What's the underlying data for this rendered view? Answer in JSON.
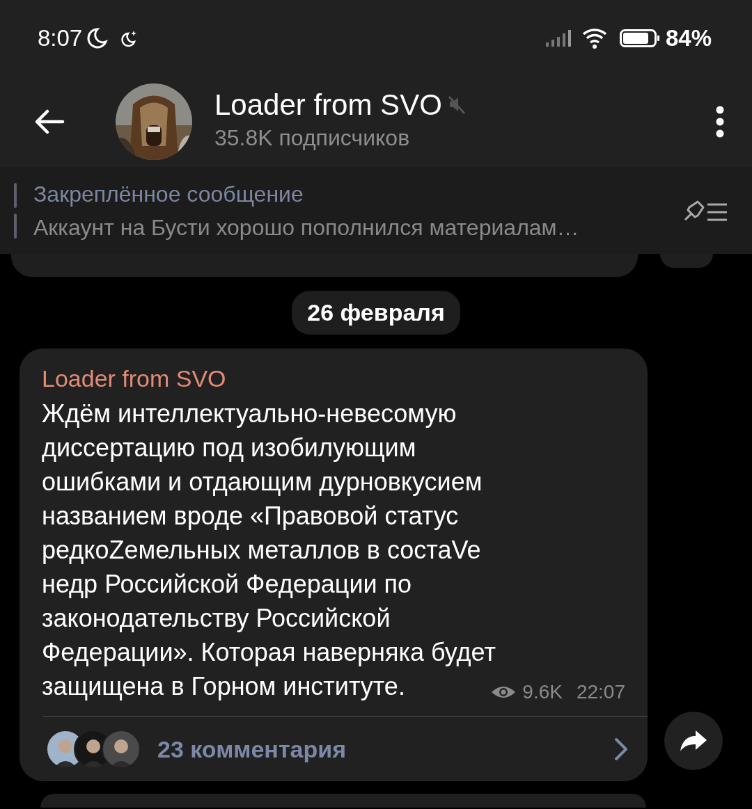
{
  "status_bar": {
    "time": "8:07",
    "battery": "84%"
  },
  "header": {
    "title": "Loader from SVO",
    "muted": true,
    "subtitle": "35.8K подписчиков"
  },
  "pinned": {
    "label": "Закреплённое сообщение",
    "text": "Аккаунт на Бусти хорошо пополнился материалам…"
  },
  "date_chip": "26 февраля",
  "post": {
    "author": "Loader from SVO",
    "text": "Ждём интеллектуально-невесомую\nдиссертацию под изобилующим\nошибками и отдающим дурновкусием\nназванием вроде «Правовой статус\nредкоZемельных металлов в состаVe\nнедр Российской Федерации по\nзаконодательству Российской\nФедерации». Которая наверняка будет\nзащищена в Горном институте.",
    "views": "9.6K",
    "time": "22:07",
    "comments": "23 комментария"
  }
}
